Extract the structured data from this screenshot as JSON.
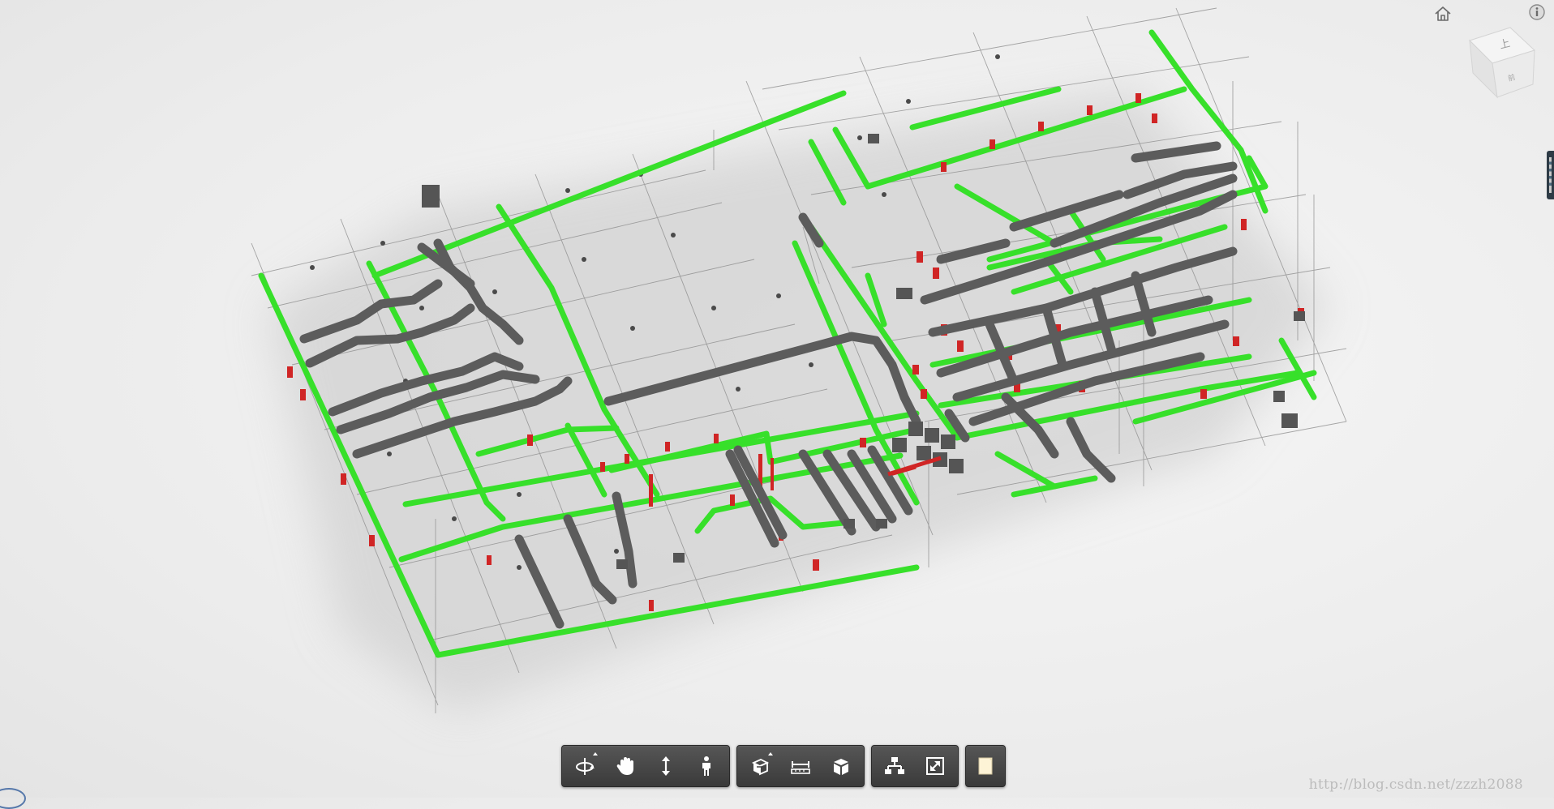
{
  "app": {
    "accent": "#3ddc2f",
    "pipe_color": "#5e5e5e",
    "fitting_color": "#d92b2b",
    "background": "#ececec"
  },
  "top_controls": {
    "home_icon": "home-icon",
    "info_icon": "info-icon"
  },
  "viewcube": {
    "top_face_label": "上",
    "front_face_label": "前"
  },
  "toolbar": {
    "groups": [
      {
        "name": "navigation",
        "tools": [
          "orbit-icon",
          "pan-icon",
          "zoom-icon",
          "first-person-icon"
        ]
      },
      {
        "name": "model-tools",
        "tools": [
          "section-icon",
          "measure-icon",
          "explode-icon"
        ]
      },
      {
        "name": "panels",
        "tools": [
          "model-browser-icon",
          "fullscreen-icon"
        ]
      },
      {
        "name": "extras",
        "tools": [
          "properties-icon"
        ]
      }
    ],
    "orbit_label": "Orbit",
    "pan_label": "Pan",
    "zoom_label": "Zoom",
    "first_person_label": "First person",
    "section_label": "Section analysis",
    "measure_label": "Measure",
    "explode_label": "Explode model",
    "browser_label": "Model browser",
    "fullscreen_label": "Full screen",
    "properties_label": "Properties"
  },
  "watermark": "http://blog.csdn.net/zzzh2088"
}
